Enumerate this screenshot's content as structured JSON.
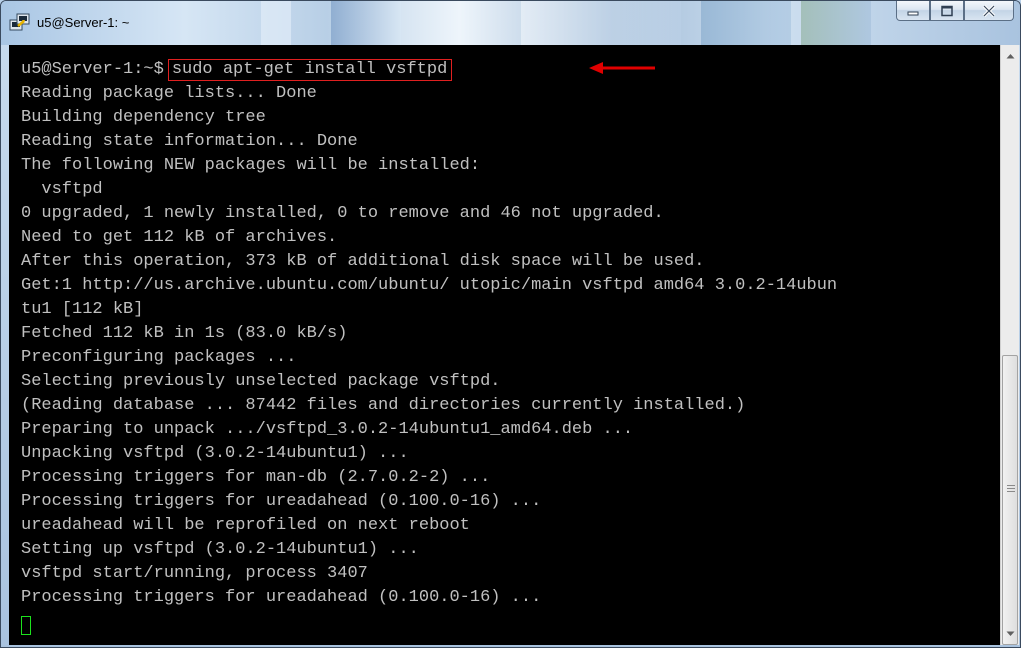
{
  "window": {
    "title": "u5@Server-1: ~"
  },
  "colors": {
    "terminal_bg": "#000000",
    "terminal_fg": "#c0c0c0",
    "highlight_box": "#e02020",
    "annotation_arrow": "#e00000",
    "cursor": "#1de21d"
  },
  "icons": {
    "app": "putty-icon",
    "minimize": "minimize-icon",
    "maximize": "maximize-icon",
    "close": "close-icon"
  },
  "terminal": {
    "prompt": "u5@Server-1:~$",
    "command": "sudo apt-get install vsftpd",
    "lines": [
      "Reading package lists... Done",
      "Building dependency tree",
      "Reading state information... Done",
      "The following NEW packages will be installed:",
      "  vsftpd",
      "0 upgraded, 1 newly installed, 0 to remove and 46 not upgraded.",
      "Need to get 112 kB of archives.",
      "After this operation, 373 kB of additional disk space will be used.",
      "Get:1 http://us.archive.ubuntu.com/ubuntu/ utopic/main vsftpd amd64 3.0.2-14ubun",
      "tu1 [112 kB]",
      "Fetched 112 kB in 1s (83.0 kB/s)",
      "Preconfiguring packages ...",
      "Selecting previously unselected package vsftpd.",
      "(Reading database ... 87442 files and directories currently installed.)",
      "Preparing to unpack .../vsftpd_3.0.2-14ubuntu1_amd64.deb ...",
      "Unpacking vsftpd (3.0.2-14ubuntu1) ...",
      "Processing triggers for man-db (2.7.0.2-2) ...",
      "Processing triggers for ureadahead (0.100.0-16) ...",
      "ureadahead will be reprofiled on next reboot",
      "Setting up vsftpd (3.0.2-14ubuntu1) ...",
      "vsftpd start/running, process 3407",
      "Processing triggers for ureadahead (0.100.0-16) ..."
    ]
  }
}
